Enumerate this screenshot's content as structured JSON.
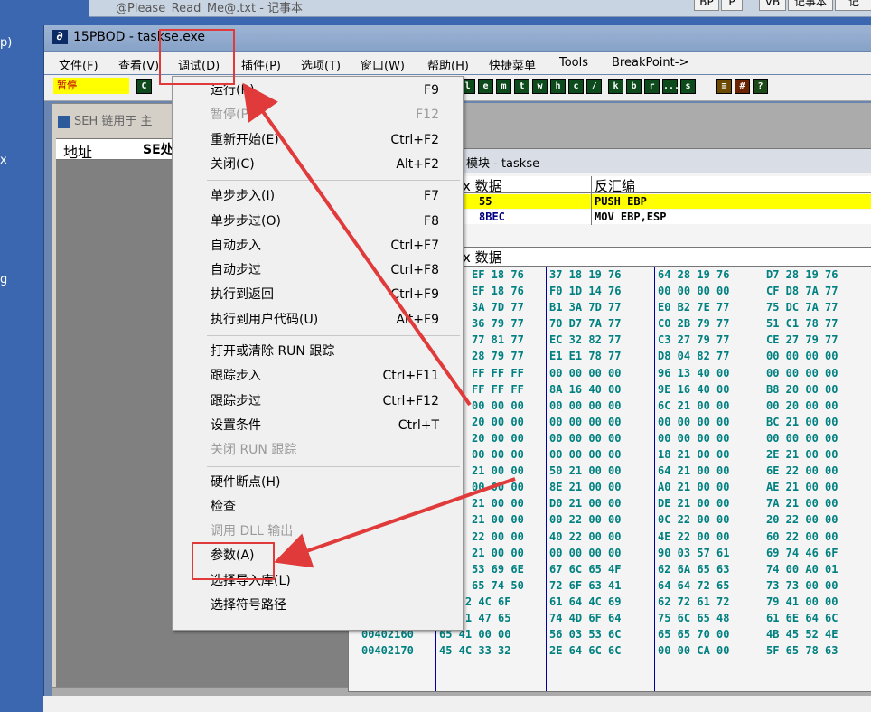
{
  "desktop": {
    "left_labels": [
      "p)",
      "x",
      "g"
    ]
  },
  "notepad": {
    "title": "@Please_Read_Me@.txt - 记事本",
    "buttons": [
      "BP",
      "P",
      "VB",
      "记事本",
      "记"
    ]
  },
  "window": {
    "title": "15PBOD - taskse.exe"
  },
  "menubar": [
    "文件(F)",
    "查看(V)",
    "调试(D)",
    "插件(P)",
    "选项(T)",
    "窗口(W)",
    "帮助(H)",
    "快捷菜单",
    "Tools",
    "BreakPoint->"
  ],
  "toolbar": {
    "status": "暂停",
    "buttons": [
      "l",
      "e",
      "m",
      "t",
      "w",
      "h",
      "c",
      "/",
      "k",
      "b",
      "r",
      "...",
      "s"
    ]
  },
  "seh": {
    "title": "SEH 链用于 主",
    "col_address": "地址",
    "col_seh": "SE处"
  },
  "cpu": {
    "title": "模块 - taskse",
    "dis_col_hex": "x 数据",
    "dis_col_asm": "反汇编",
    "dis_rows": [
      {
        "hex": "55",
        "asm": "PUSH EBP",
        "highlight": true
      },
      {
        "hex": "8BEC",
        "asm": "MOV EBP,ESP",
        "highlight": false
      }
    ],
    "dump_col_hex": "x 数据",
    "dump_rows": [
      {
        "addr": "",
        "bytes": [
          "EF 18 76",
          "37 18 19 76",
          "64 28 19 76",
          "D7 28 19 76"
        ]
      },
      {
        "addr": "",
        "bytes": [
          "EF 18 76",
          "F0 1D 14 76",
          "00 00 00 00",
          "CF D8 7A 77"
        ]
      },
      {
        "addr": "",
        "bytes": [
          "3A 7D 77",
          "B1 3A 7D 77",
          "E0 B2 7E 77",
          "75 DC 7A 77"
        ]
      },
      {
        "addr": "",
        "bytes": [
          "36 79 77",
          "70 D7 7A 77",
          "C0 2B 79 77",
          "51 C1 78 77"
        ]
      },
      {
        "addr": "",
        "bytes": [
          "77 81 77",
          "EC 32 82 77",
          "C3 27 79 77",
          "CE 27 79 77"
        ]
      },
      {
        "addr": "",
        "bytes": [
          "28 79 77",
          "E1 E1 78 77",
          "D8 04 82 77",
          "00 00 00 00"
        ]
      },
      {
        "addr": "",
        "bytes": [
          "FF FF FF",
          "00 00 00 00",
          "96 13 40 00",
          "00 00 00 00"
        ]
      },
      {
        "addr": "",
        "bytes": [
          "FF FF FF",
          "8A 16 40 00",
          "9E 16 40 00",
          "B8 20 00 00"
        ]
      },
      {
        "addr": "",
        "bytes": [
          "00 00 00",
          "00 00 00 00",
          "6C 21 00 00",
          "00 20 00 00"
        ]
      },
      {
        "addr": "",
        "bytes": [
          "20 00 00",
          "00 00 00 00",
          "00 00 00 00",
          "BC 21 00 00"
        ]
      },
      {
        "addr": "",
        "bytes": [
          "20 00 00",
          "00 00 00 00",
          "00 00 00 00",
          "00 00 00 00"
        ]
      },
      {
        "addr": "",
        "bytes": [
          "00 00 00",
          "00 00 00 00",
          "18 21 00 00",
          "2E 21 00 00"
        ]
      },
      {
        "addr": "",
        "bytes": [
          "21 00 00",
          "50 21 00 00",
          "64 21 00 00",
          "6E 22 00 00"
        ]
      },
      {
        "addr": "",
        "bytes": [
          "00 00 00",
          "8E 21 00 00",
          "A0 21 00 00",
          "AE 21 00 00"
        ]
      },
      {
        "addr": "",
        "bytes": [
          "21 00 00",
          "D0 21 00 00",
          "DE 21 00 00",
          "7A 21 00 00"
        ]
      },
      {
        "addr": "",
        "bytes": [
          "21 00 00",
          "00 22 00 00",
          "0C 22 00 00",
          "20 22 00 00"
        ]
      },
      {
        "addr": "",
        "bytes": [
          "22 00 00",
          "40 22 00 00",
          "4E 22 00 00",
          "60 22 00 00"
        ]
      },
      {
        "addr": "",
        "bytes": [
          "21 00 00",
          "00 00 00 00",
          "90 03 57 61",
          "69 74 46 6F"
        ]
      },
      {
        "addr": "",
        "bytes": [
          "53 69 6E",
          "67 6C 65 4F",
          "62 6A 65 63",
          "74 00 A0 01"
        ]
      },
      {
        "addr": "",
        "bytes": [
          "65 74 50",
          "72 6F 63 41",
          "64 64 72 65",
          "73 73 00 00"
        ]
      },
      {
        "addr": "00402140",
        "bytes": [
          "52 02 4C 6F",
          "61 64 4C 69",
          "62 72 61 72",
          "79 41 00 00"
        ]
      },
      {
        "addr": "00402150",
        "bytes": [
          "7F 01 47 65",
          "74 4D 6F 64",
          "75 6C 65 48",
          "61 6E 64 6C"
        ]
      },
      {
        "addr": "00402160",
        "bytes": [
          "65 41 00 00",
          "56 03 53 6C",
          "65 65 70 00",
          "4B 45 52 4E"
        ]
      },
      {
        "addr": "00402170",
        "bytes": [
          "45 4C 33 32",
          "2E 64 6C 6C",
          "00 00 CA 00",
          "5F 65 78 63"
        ]
      }
    ]
  },
  "debug_menu": {
    "items": [
      {
        "label": "运行(R)",
        "shortcut": "F9",
        "disabled": false
      },
      {
        "label": "暂停(P)",
        "shortcut": "F12",
        "disabled": true
      },
      {
        "label": "重新开始(E)",
        "shortcut": "Ctrl+F2",
        "disabled": false
      },
      {
        "label": "关闭(C)",
        "shortcut": "Alt+F2",
        "disabled": false
      },
      {
        "sep": true
      },
      {
        "label": "单步步入(I)",
        "shortcut": "F7",
        "disabled": false
      },
      {
        "label": "单步步过(O)",
        "shortcut": "F8",
        "disabled": false
      },
      {
        "label": "自动步入",
        "shortcut": "Ctrl+F7",
        "disabled": false
      },
      {
        "label": "自动步过",
        "shortcut": "Ctrl+F8",
        "disabled": false
      },
      {
        "label": "执行到返回",
        "shortcut": "Ctrl+F9",
        "disabled": false
      },
      {
        "label": "执行到用户代码(U)",
        "shortcut": "Alt+F9",
        "disabled": false
      },
      {
        "sep": true
      },
      {
        "label": "打开或清除 RUN 跟踪",
        "shortcut": "",
        "disabled": false
      },
      {
        "label": "跟踪步入",
        "shortcut": "Ctrl+F11",
        "disabled": false
      },
      {
        "label": "跟踪步过",
        "shortcut": "Ctrl+F12",
        "disabled": false
      },
      {
        "label": "设置条件",
        "shortcut": "Ctrl+T",
        "disabled": false
      },
      {
        "label": "关闭 RUN 跟踪",
        "shortcut": "",
        "disabled": true
      },
      {
        "sep": true
      },
      {
        "label": "硬件断点(H)",
        "shortcut": "",
        "disabled": false
      },
      {
        "label": "检查",
        "shortcut": "",
        "disabled": false
      },
      {
        "label": "调用 DLL 输出",
        "shortcut": "",
        "disabled": true
      },
      {
        "label": "参数(A)",
        "shortcut": "",
        "disabled": false
      },
      {
        "label": "选择导入库(L)",
        "shortcut": "",
        "disabled": false
      },
      {
        "label": "选择符号路径",
        "shortcut": "",
        "disabled": false
      }
    ]
  },
  "colors": {
    "accent_red": "#e03a3a",
    "highlight_yellow": "#ffff00",
    "hex_teal": "#008080"
  }
}
